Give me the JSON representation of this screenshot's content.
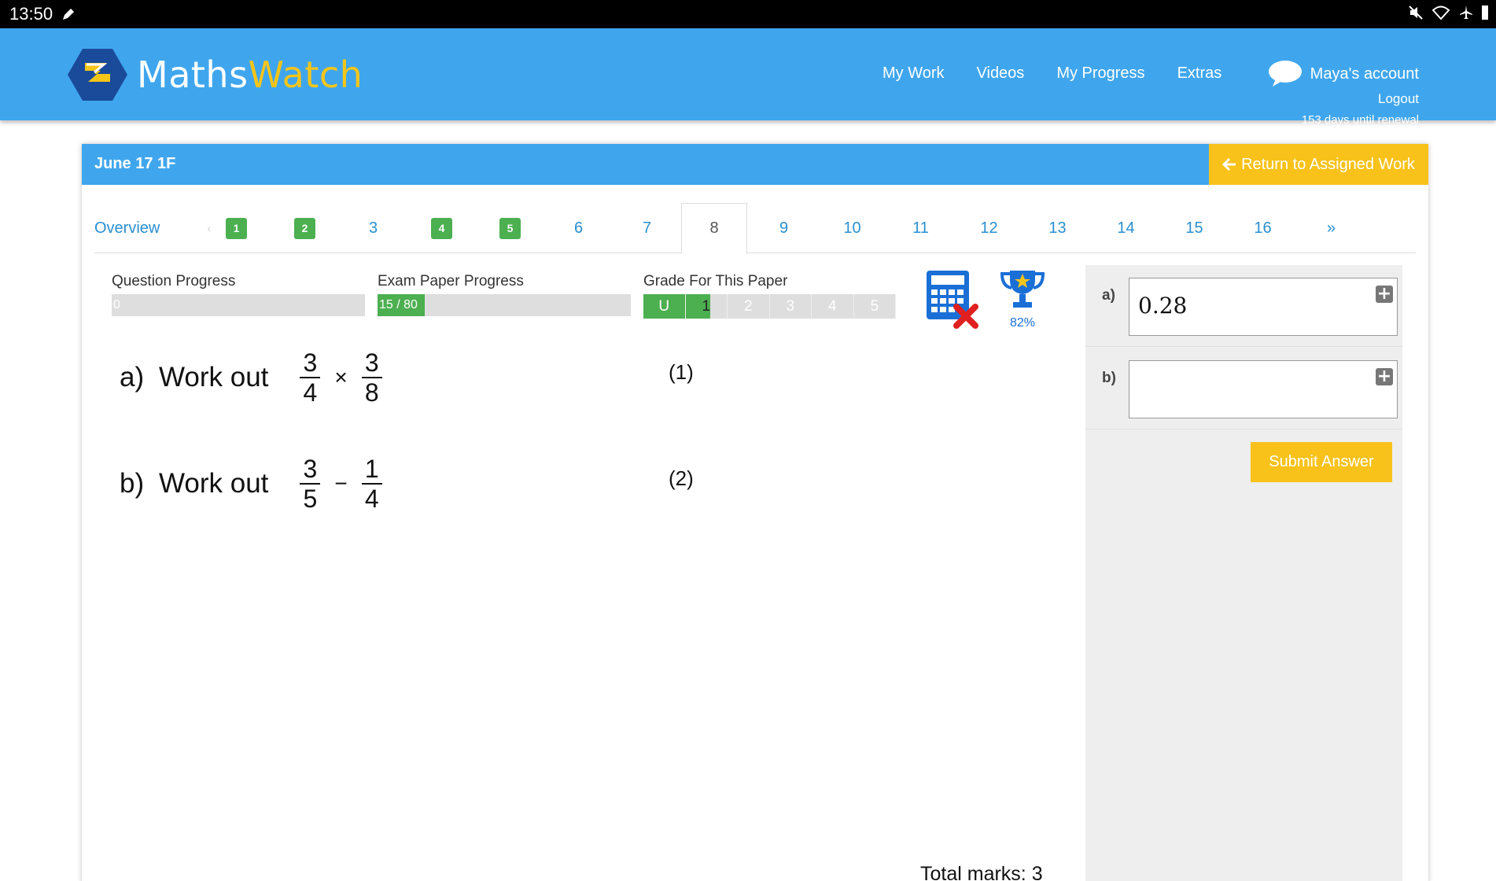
{
  "status": {
    "time": "13:50"
  },
  "header": {
    "logo_part1": "Maths",
    "logo_part2": "Watch",
    "nav": [
      "My Work",
      "Videos",
      "My Progress",
      "Extras"
    ],
    "account_name": "Maya's account",
    "logout": "Logout",
    "renewal": "153 days until renewal"
  },
  "card": {
    "title": "June 17 1F",
    "return_label": "Return to Assigned Work"
  },
  "tabs": {
    "overview": "Overview",
    "prev": "‹",
    "items": [
      "1",
      "2",
      "3",
      "4",
      "5",
      "6",
      "7",
      "8",
      "9",
      "10",
      "11",
      "12",
      "13",
      "14",
      "15",
      "16"
    ],
    "next": "»",
    "active": "8"
  },
  "progress": {
    "question_label": "Question Progress",
    "question_value": "0",
    "question_fraction": 0,
    "exam_label": "Exam Paper Progress",
    "exam_value": "15 / 80",
    "exam_fraction": 0.1875,
    "grade_label": "Grade For This Paper",
    "grades": [
      "U",
      "1",
      "2",
      "3",
      "4",
      "5"
    ],
    "trophy_percent": "82%"
  },
  "questions": [
    {
      "letter": "a)",
      "text": "Work out",
      "num1": "3",
      "den1": "4",
      "op": "×",
      "num2": "3",
      "den2": "8",
      "marks": "(1)"
    },
    {
      "letter": "b)",
      "text": "Work out",
      "num1": "3",
      "den1": "5",
      "op": "−",
      "num2": "1",
      "den2": "4",
      "marks": "(2)"
    }
  ],
  "total_marks": "Total marks: 3",
  "answers": {
    "a_label": "a)",
    "a_value": "0.28",
    "b_label": "b)",
    "b_value": "",
    "submit": "Submit Answer"
  },
  "icons": {
    "calculator": "calculator-not-allowed-icon",
    "trophy": "trophy-icon",
    "chat": "chat-bubble-icon"
  },
  "colors": {
    "header_blue": "#3fa6ee",
    "accent_yellow": "#f8c21a",
    "green": "#4caf50"
  }
}
